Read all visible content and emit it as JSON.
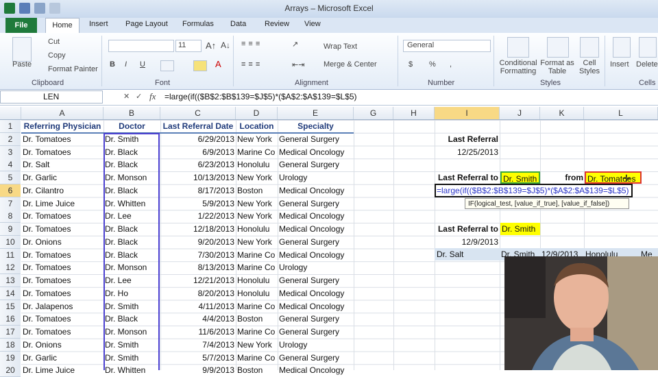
{
  "window": {
    "title": "Arrays – Microsoft Excel"
  },
  "tabs": [
    "File",
    "Home",
    "Insert",
    "Page Layout",
    "Formulas",
    "Data",
    "Review",
    "View"
  ],
  "ribbon": {
    "clipboard": {
      "paste": "Paste",
      "cut": "Cut",
      "copy": "Copy",
      "format_painter": "Format Painter",
      "label": "Clipboard"
    },
    "font": {
      "size": "11",
      "bold": "B",
      "italic": "I",
      "underline": "U",
      "label": "Font"
    },
    "alignment": {
      "wrap": "Wrap Text",
      "merge": "Merge & Center",
      "label": "Alignment"
    },
    "number": {
      "format": "General",
      "currency": "$",
      "percent": "%",
      "comma": ",",
      "label": "Number"
    },
    "styles": {
      "conditional": "Conditional Formatting",
      "table": "Format as Table",
      "cell": "Cell Styles",
      "label": "Styles"
    },
    "cells": {
      "insert": "Insert",
      "delete": "Delete",
      "label": "Cells"
    }
  },
  "formula_bar": {
    "name_box": "LEN",
    "fx": "fx",
    "formula": "=large(if(($B$2:$B$139=$J$5)*($A$2:$A$139=$L$5)"
  },
  "columns": [
    "A",
    "B",
    "C",
    "D",
    "E",
    "G",
    "H",
    "I",
    "J",
    "K",
    "L"
  ],
  "rows": [
    "1",
    "2",
    "3",
    "4",
    "5",
    "6",
    "7",
    "8",
    "9",
    "10",
    "11",
    "12",
    "13",
    "14",
    "15",
    "16",
    "17",
    "18",
    "19",
    "20"
  ],
  "headers": {
    "A": "Referring Physician",
    "B": "Doctor",
    "C": "Last Referral Date",
    "D": "Location",
    "E": "Specialty"
  },
  "data": [
    [
      "Dr. Tomatoes",
      "Dr. Smith",
      "6/29/2013",
      "New York",
      "General Surgery"
    ],
    [
      "Dr. Tomatoes",
      "Dr. Black",
      "6/9/2013",
      "Marine Co",
      "Medical Oncology"
    ],
    [
      "Dr. Salt",
      "Dr. Black",
      "6/23/2013",
      "Honolulu",
      "General Surgery"
    ],
    [
      "Dr. Garlic",
      "Dr. Monson",
      "10/13/2013",
      "New York",
      "Urology"
    ],
    [
      "Dr. Cilantro",
      "Dr. Black",
      "8/17/2013",
      "Boston",
      "Medical Oncology"
    ],
    [
      "Dr. Lime Juice",
      "Dr. Whitten",
      "5/9/2013",
      "New York",
      "General Surgery"
    ],
    [
      "Dr. Tomatoes",
      "Dr. Lee",
      "1/22/2013",
      "New York",
      "Medical Oncology"
    ],
    [
      "Dr. Tomatoes",
      "Dr. Black",
      "12/18/2013",
      "Honolulu",
      "Medical Oncology"
    ],
    [
      "Dr. Onions",
      "Dr. Black",
      "9/20/2013",
      "New York",
      "General Surgery"
    ],
    [
      "Dr. Tomatoes",
      "Dr. Black",
      "7/30/2013",
      "Marine Co",
      "Medical Oncology"
    ],
    [
      "Dr. Tomatoes",
      "Dr. Monson",
      "8/13/2013",
      "Marine Co",
      "Urology"
    ],
    [
      "Dr. Tomatoes",
      "Dr. Lee",
      "12/21/2013",
      "Honolulu",
      "General Surgery"
    ],
    [
      "Dr. Tomatoes",
      "Dr. Ho",
      "8/20/2013",
      "Honolulu",
      "Medical Oncology"
    ],
    [
      "Dr. Jalapenos",
      "Dr. Smith",
      "4/11/2013",
      "Marine Co",
      "Medical Oncology"
    ],
    [
      "Dr. Tomatoes",
      "Dr. Black",
      "4/4/2013",
      "Boston",
      "General Surgery"
    ],
    [
      "Dr. Tomatoes",
      "Dr. Monson",
      "11/6/2013",
      "Marine Co",
      "General Surgery"
    ],
    [
      "Dr. Onions",
      "Dr. Smith",
      "7/4/2013",
      "New York",
      "Urology"
    ],
    [
      "Dr. Garlic",
      "Dr. Smith",
      "5/7/2013",
      "Marine Co",
      "General Surgery"
    ],
    [
      "Dr. Lime Juice",
      "Dr. Whitten",
      "9/9/2013",
      "Boston",
      "Medical Oncology"
    ]
  ],
  "side": {
    "last_referral_label": "Last Referral",
    "last_referral_value": "12/25/2013",
    "last_referral_to": "Last Referral to",
    "doctor": "Dr. Smith",
    "from": "from",
    "physician": "Dr. Tomatoes",
    "editing_formula": "=large(if(($B$2:$B$139=$J$5)*($A$2:$A$139=$L$5)",
    "tooltip": "IF(logical_test, [value_if_true], [value_if_false])",
    "last_referral_to_2": "Last Referral to",
    "doctor_2": "Dr. Smith",
    "value_2": "12/9/2013",
    "row11_a": "Dr. Salt",
    "row11_b": "Dr. Smith",
    "row11_c": "12/9/2013",
    "row11_d": "Honolulu",
    "row11_e": "Me"
  }
}
